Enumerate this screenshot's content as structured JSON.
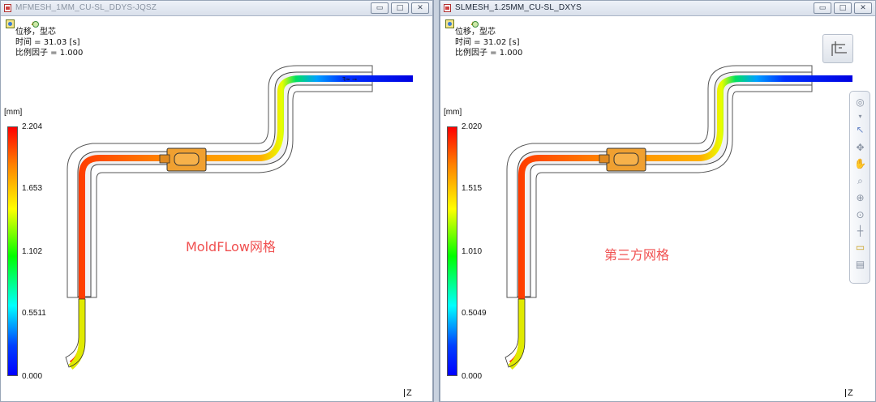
{
  "left": {
    "title": "MFMESH_1MM_CU-SL_DDYS-JQSZ",
    "info": [
      "位移，型芯",
      "时间 = 31.03 [s]",
      "比例因子 = 1.000"
    ],
    "unit": "[mm]",
    "scale": [
      "2.204",
      "1.653",
      "1.102",
      "0.5511",
      "0.000"
    ],
    "annotation": "MoldFLow网格",
    "axis": "Z"
  },
  "right": {
    "title": "SLMESH_1.25MM_CU-SL_DXYS",
    "info": [
      "位移，型芯",
      "时间 = 31.02 [s]",
      "比例因子 = 1.000"
    ],
    "unit": "[mm]",
    "scale": [
      "2.020",
      "1.515",
      "1.010",
      "0.5049",
      "0.000"
    ],
    "annotation": "第三方网格",
    "axis": "Z"
  },
  "window_buttons": [
    "▭",
    "□",
    "✕"
  ],
  "icons": {
    "nav_tools": [
      "orbit-ring-icon",
      "select-arrow-icon",
      "rotate-icon",
      "pan-hand-icon",
      "zoom-rect-icon",
      "zoom-icon",
      "zoom-fit-icon",
      "center-icon",
      "measure-icon",
      "print-icon"
    ]
  },
  "colors": {
    "scale_top": "#ff0000",
    "scale_bottom": "#0000ff",
    "annotation": "#f05050"
  }
}
